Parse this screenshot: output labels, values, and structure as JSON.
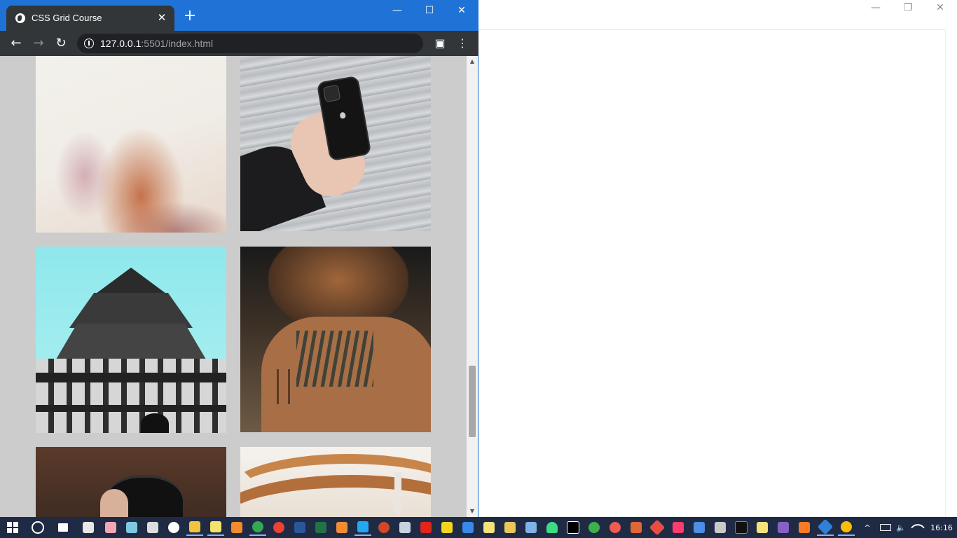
{
  "browser": {
    "tab_title": "CSS Grid Course",
    "url_host": "127.0.0.1",
    "url_rest": ":5501/index.html"
  },
  "icons": {
    "minimize": "—",
    "maximize": "☐",
    "close": "✕",
    "tab_close": "✕",
    "new_tab": "+",
    "back": "←",
    "forward": "→",
    "reload": "↻",
    "menu": "⋮",
    "profile": "▣",
    "scroll_up": "▲",
    "scroll_down": "▼",
    "bg_restore": "❐"
  },
  "taskbar": {
    "clock": "16:16",
    "tray_chevron": "^",
    "volume": "🔈"
  },
  "colors": {
    "accent": "#1f73d6",
    "taskbar": "#1f2a44",
    "page_bg": "#cccccc"
  }
}
